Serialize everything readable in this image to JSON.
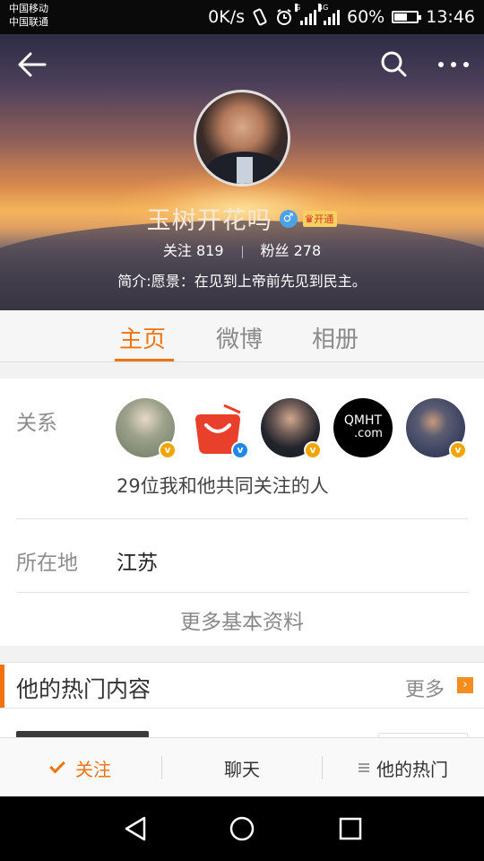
{
  "status_bar": {
    "carrier_1": "中国移动",
    "carrier_2": "中国联通",
    "speed": "0K/s",
    "battery_percent": "60%",
    "battery_level": 0.6,
    "time": "13:46",
    "signal_1_tag": "G",
    "signal_2_tag": "4G"
  },
  "profile": {
    "name": "玉树开花吗",
    "gender_icon": "♂",
    "vip_label": "开通",
    "following_label": "关注",
    "following_count": "819",
    "fans_label": "粉丝",
    "fans_count": "278",
    "bio": "简介:愿景：在见到上帝前先见到民主。"
  },
  "tabs": [
    {
      "label": "主页",
      "active": true
    },
    {
      "label": "微博",
      "active": false
    },
    {
      "label": "相册",
      "active": false
    }
  ],
  "info": {
    "relation_label": "关系",
    "mutual_text": "29位我和他共同关注的人",
    "friend_avatars": [
      {
        "badge": "gold"
      },
      {
        "badge": "blue"
      },
      {
        "badge": "gold"
      },
      {
        "text": "QMHT",
        "subtext": ".com"
      },
      {
        "badge": "gold"
      }
    ],
    "location_label": "所在地",
    "location_value": "江苏",
    "more_info": "更多基本资料"
  },
  "hot": {
    "title": "他的热门内容",
    "more": "更多"
  },
  "actions": {
    "follow": "关注",
    "chat": "聊天",
    "hot": "他的热门"
  },
  "colors": {
    "accent": "#f0730f",
    "verified_gold": "#f2a500",
    "verified_blue": "#1e88e5",
    "gender_blue": "#4da2e6"
  }
}
